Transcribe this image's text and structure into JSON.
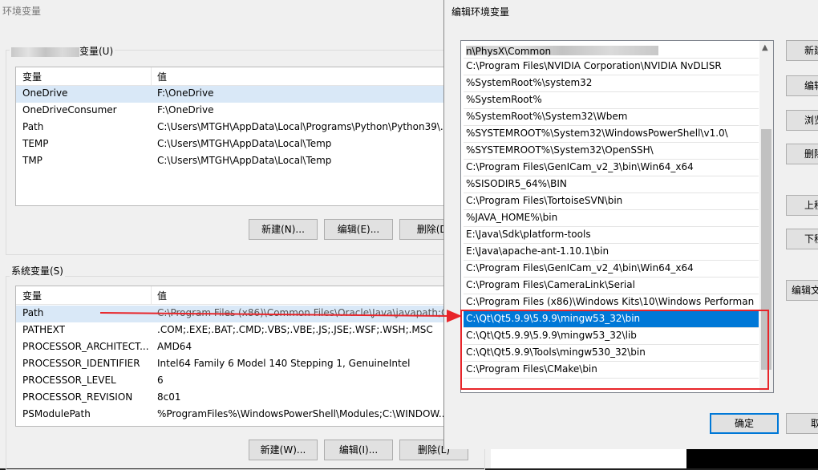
{
  "bg_window": {
    "title": "环境变量",
    "user_group_label": "变量(U)",
    "user_vars": {
      "headers": [
        "变量",
        "值"
      ],
      "rows": [
        [
          "OneDrive",
          "F:\\OneDrive"
        ],
        [
          "OneDriveConsumer",
          "F:\\OneDrive"
        ],
        [
          "Path",
          "C:\\Users\\MTGH\\AppData\\Local\\Programs\\Python\\Python39\\..."
        ],
        [
          "TEMP",
          "C:\\Users\\MTGH\\AppData\\Local\\Temp"
        ],
        [
          "TMP",
          "C:\\Users\\MTGH\\AppData\\Local\\Temp"
        ]
      ],
      "buttons": [
        "新建(N)...",
        "编辑(E)...",
        "删除(D)"
      ]
    },
    "sys_group_label": "系统变量(S)",
    "sys_vars": {
      "headers": [
        "变量",
        "值"
      ],
      "rows": [
        [
          "Path",
          "C:\\Program Files (x86)\\Common Files\\Oracle\\Java\\javapath;C..."
        ],
        [
          "PATHEXT",
          ".COM;.EXE;.BAT;.CMD;.VBS;.VBE;.JS;.JSE;.WSF;.WSH;.MSC"
        ],
        [
          "PROCESSOR_ARCHITECT...",
          "AMD64"
        ],
        [
          "PROCESSOR_IDENTIFIER",
          "Intel64 Family 6 Model 140 Stepping 1, GenuineIntel"
        ],
        [
          "PROCESSOR_LEVEL",
          "6"
        ],
        [
          "PROCESSOR_REVISION",
          "8c01"
        ],
        [
          "PSModulePath",
          "%ProgramFiles%\\WindowsPowerShell\\Modules;C:\\WINDOW..."
        ]
      ],
      "buttons": [
        "新建(W)...",
        "编辑(I)...",
        "删除(L)"
      ]
    }
  },
  "edit_window": {
    "title": "编辑环境变量",
    "paths": [
      "n\\PhysX\\Common",
      "C:\\Program Files\\NVIDIA Corporation\\NVIDIA NvDLISR",
      "%SystemRoot%\\system32",
      "%SystemRoot%",
      "%SystemRoot%\\System32\\Wbem",
      "%SYSTEMROOT%\\System32\\WindowsPowerShell\\v1.0\\",
      "%SYSTEMROOT%\\System32\\OpenSSH\\",
      "C:\\Program Files\\GenICam_v2_3\\bin\\Win64_x64",
      "%SISODIR5_64%\\BIN",
      "C:\\Program Files\\TortoiseSVN\\bin",
      "%JAVA_HOME%\\bin",
      "E:\\Java\\Sdk\\platform-tools",
      "E:\\Java\\apache-ant-1.10.1\\bin",
      "C:\\Program Files\\GenICam_v2_4\\bin\\Win64_x64",
      "C:\\Program Files\\CameraLink\\Serial",
      "C:\\Program Files (x86)\\Windows Kits\\10\\Windows Performan...",
      "C:\\Qt\\Qt5.9.9\\5.9.9\\mingw53_32\\bin",
      "C:\\Qt\\Qt5.9.9\\5.9.9\\mingw53_32\\lib",
      "C:\\Qt\\Qt5.9.9\\Tools\\mingw530_32\\bin",
      "C:\\Program Files\\CMake\\bin"
    ],
    "side_buttons": [
      "新建(N)",
      "编辑(E)",
      "浏览(B)...",
      "删除(D)",
      "上移(U)",
      "下移(O)",
      "编辑文本(T)..."
    ],
    "ok_label": "确定",
    "cancel_label": "取消"
  },
  "colors": {
    "highlight_box": "#e8252a",
    "arrow": "#e8252a",
    "selection": "#0078d7"
  }
}
